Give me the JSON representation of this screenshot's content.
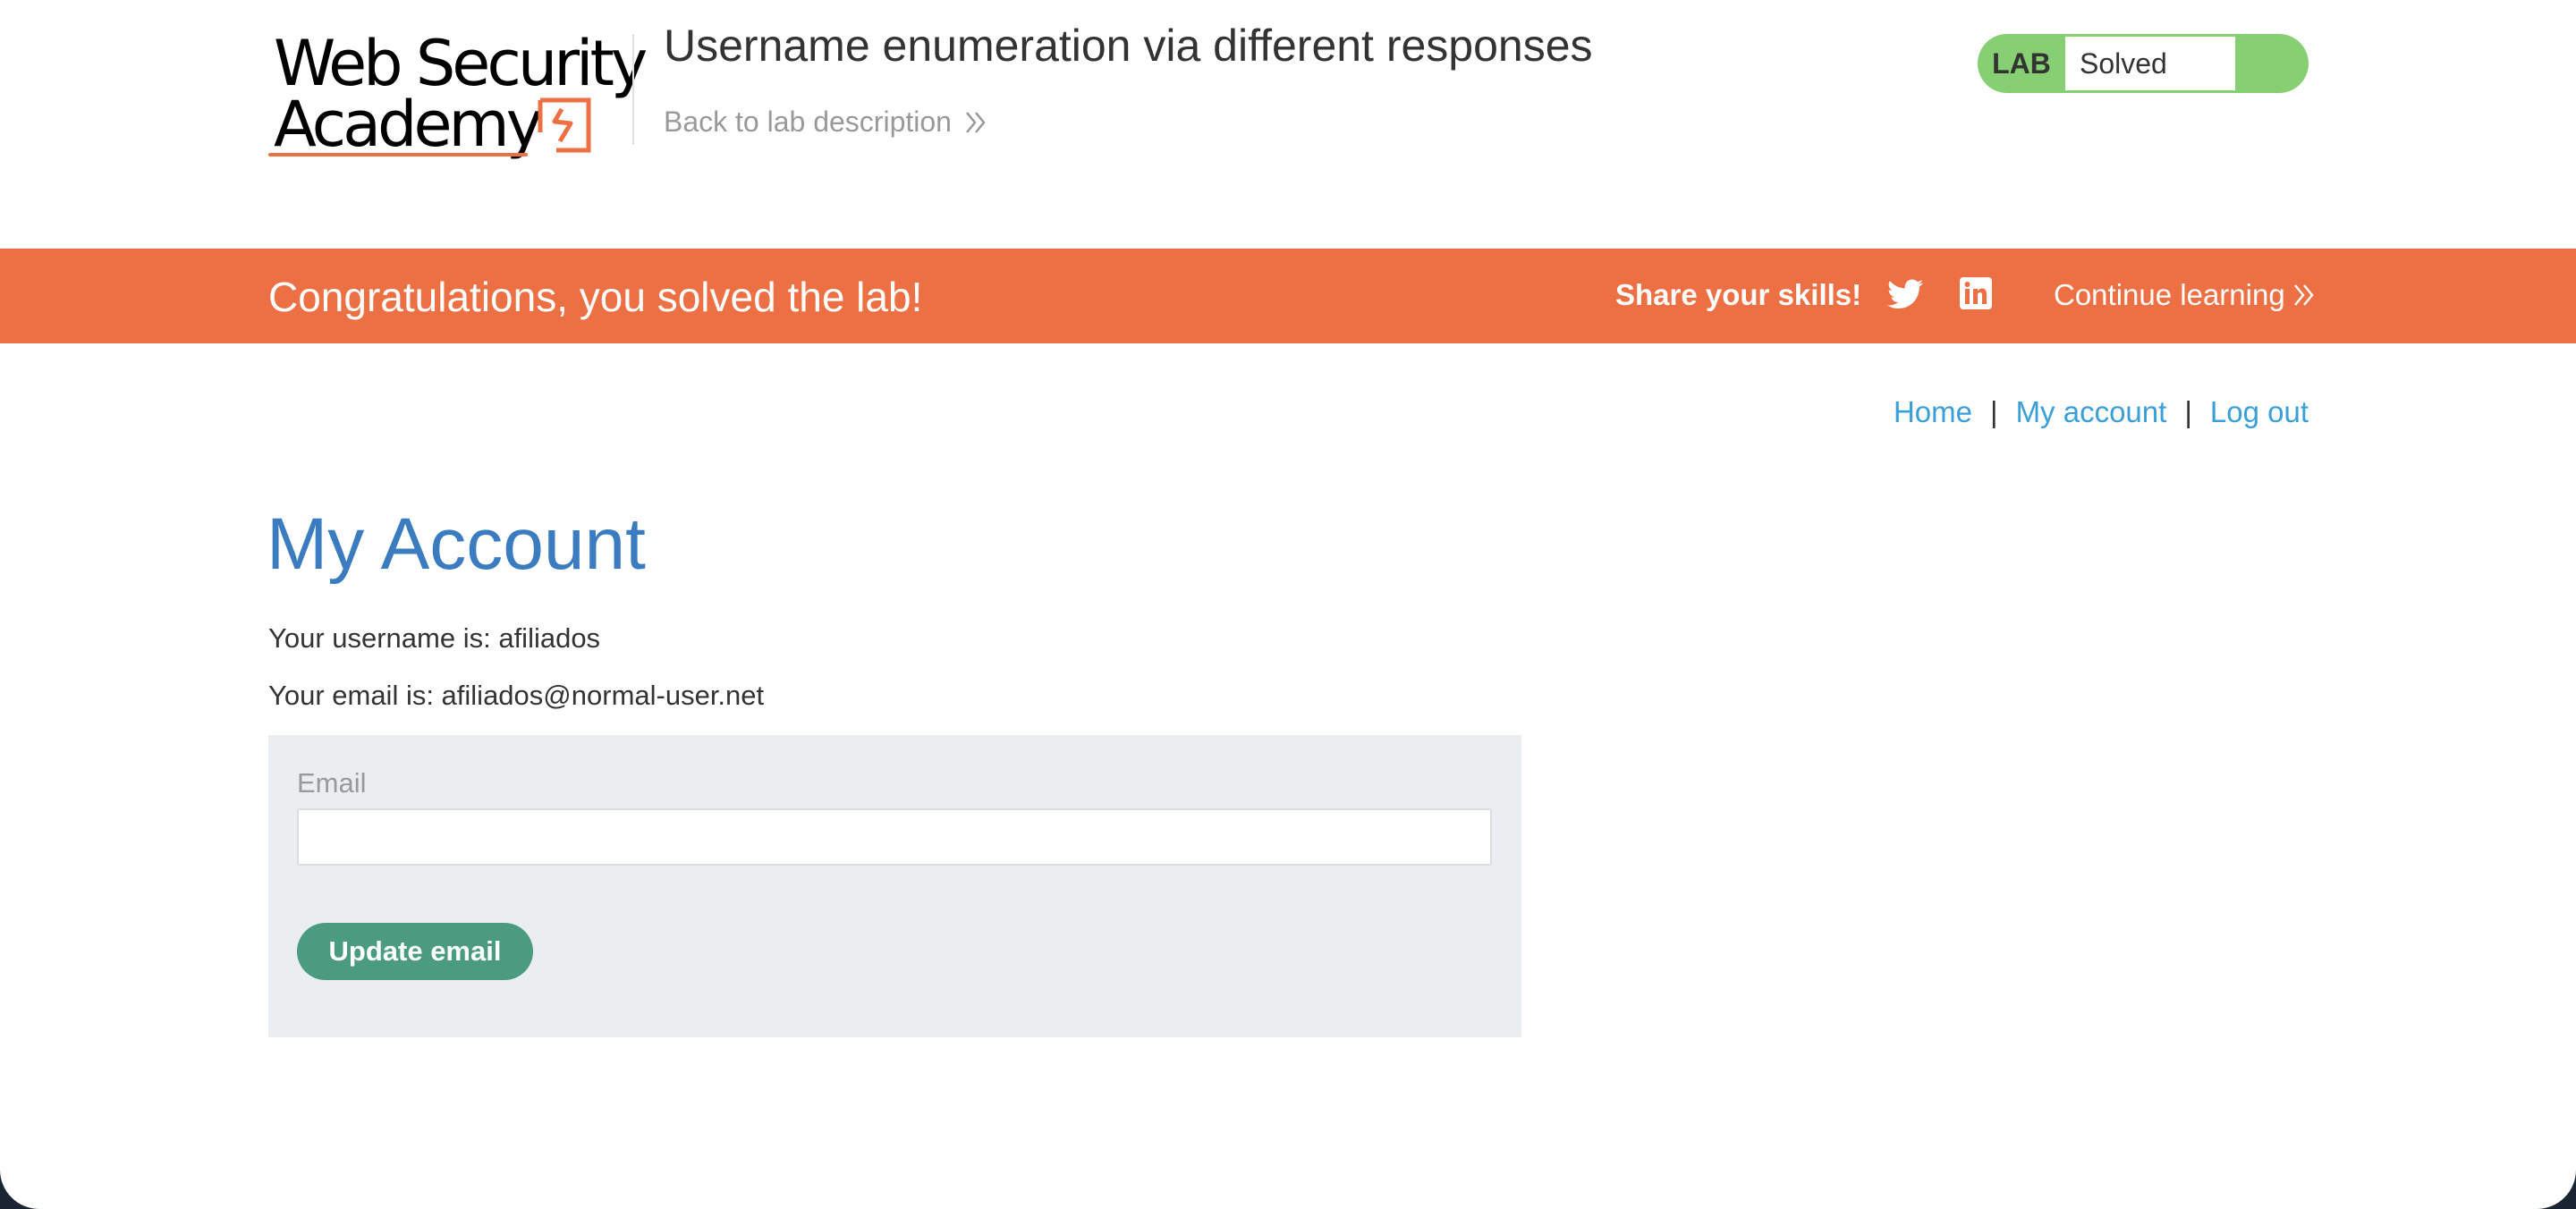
{
  "header": {
    "logo_line1": "Web Security",
    "logo_line2": "Academy",
    "lab_title": "Username enumeration via different responses",
    "back_link": "Back to lab description",
    "lab_badge": "LAB",
    "lab_status": "Solved"
  },
  "banner": {
    "message": "Congratulations, you solved the lab!",
    "share_label": "Share your skills!",
    "continue_label": "Continue learning"
  },
  "nav": {
    "home": "Home",
    "separator": "|",
    "my_account": "My account",
    "log_out": "Log out"
  },
  "account": {
    "heading": "My Account",
    "username_line": "Your username is: afiliados",
    "email_line": "Your email is: afiliados@normal-user.net",
    "email_label": "Email",
    "email_value": "",
    "update_button": "Update email"
  },
  "colors": {
    "banner": "#ec7043",
    "lab_status": "#86cf73",
    "heading": "#3b7bbf",
    "link": "#3a9fd8",
    "button": "#4a9b7f",
    "panel": "#ebeef0"
  }
}
